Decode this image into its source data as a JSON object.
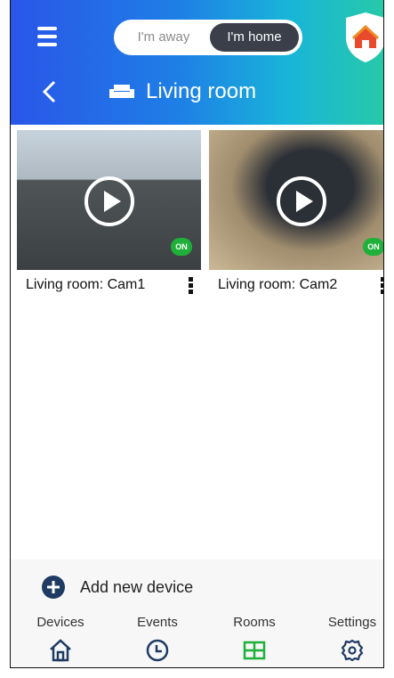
{
  "header": {
    "mode_toggle": {
      "away_label": "I'm away",
      "home_label": "I'm home",
      "selected": "home"
    },
    "page_title": "Living room"
  },
  "cameras": [
    {
      "name": "Living room: Cam1",
      "status": "ON"
    },
    {
      "name": "Living room: Cam2",
      "status": "ON"
    }
  ],
  "bottom": {
    "add_device_label": "Add new device",
    "nav": [
      {
        "label": "Devices",
        "icon": "house-icon"
      },
      {
        "label": "Events",
        "icon": "clock-icon"
      },
      {
        "label": "Rooms",
        "icon": "grid-icon",
        "active": true
      },
      {
        "label": "Settings",
        "icon": "gear-icon"
      }
    ]
  },
  "colors": {
    "accent_green": "#1fb03a",
    "header_start": "#2a56e8",
    "header_end": "#27c9a9"
  }
}
